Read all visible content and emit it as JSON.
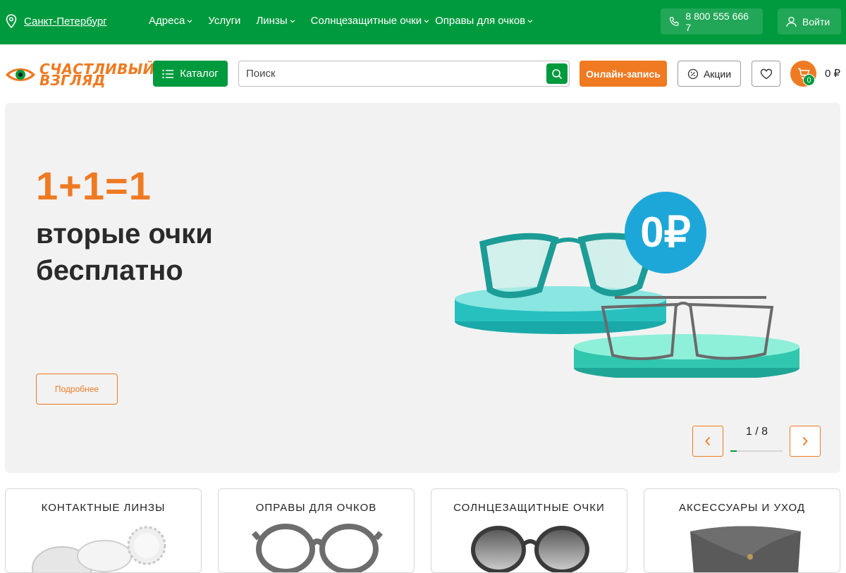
{
  "topbar": {
    "city": "Санкт-Петербург",
    "nav": [
      {
        "label": "Адреса",
        "has_dropdown": true
      },
      {
        "label": "Услуги",
        "has_dropdown": false
      },
      {
        "label": "Линзы",
        "has_dropdown": true
      },
      {
        "label": "Солнцезащитные очки",
        "has_dropdown": true
      },
      {
        "label": "Оправы для очков",
        "has_dropdown": true
      }
    ],
    "phone": "8 800 555 666 7",
    "login": "Войти",
    "brand_color": "#009a3e"
  },
  "header": {
    "logo_line1": "СЧАСТЛИВЫЙ",
    "logo_line2": "ВЗГЛЯД",
    "catalog": "Каталог",
    "search_placeholder": "Поиск",
    "online_booking": "Онлайн-запись",
    "promotions": "Акции",
    "cart_count": "0",
    "cart_total": "0 ₽",
    "accent_color": "#ef7a22"
  },
  "banner": {
    "title": "1+1=1",
    "subtitle": "вторые очки бесплатно",
    "price_badge": "0₽",
    "more": "Подробнее",
    "pager": "1 / 8",
    "progress_fraction": 0.125
  },
  "categories": [
    {
      "title": "КОНТАКТНЫЕ ЛИНЗЫ"
    },
    {
      "title": "ОПРАВЫ ДЛЯ ОЧКОВ"
    },
    {
      "title": "СОЛНЦЕЗАЩИТНЫЕ ОЧКИ"
    },
    {
      "title": "АКСЕССУАРЫ И УХОД"
    }
  ]
}
